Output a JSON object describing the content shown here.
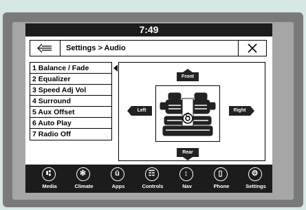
{
  "status": {
    "time": "7:49"
  },
  "header": {
    "breadcrumb": "Settings > Audio"
  },
  "menu": {
    "items": [
      {
        "label": "1 Balance / Fade"
      },
      {
        "label": "2 Equalizer"
      },
      {
        "label": "3 Speed Adj Vol"
      },
      {
        "label": "4 Surround"
      },
      {
        "label": "5 Aux Offset"
      },
      {
        "label": "6 Auto Play"
      },
      {
        "label": "7 Radio Off"
      }
    ]
  },
  "balance": {
    "front_label": "Front",
    "rear_label": "Rear",
    "left_label": "Left",
    "right_label": "Right",
    "center_label": "C"
  },
  "dock": {
    "items": [
      {
        "label": "Media",
        "icon": "usb-icon"
      },
      {
        "label": "Climate",
        "icon": "fan-icon"
      },
      {
        "label": "Apps",
        "icon": "apps-icon"
      },
      {
        "label": "Controls",
        "icon": "controls-icon"
      },
      {
        "label": "Nav",
        "icon": "nav-icon"
      },
      {
        "label": "Phone",
        "icon": "phone-icon"
      },
      {
        "label": "Settings",
        "icon": "gear-icon"
      }
    ]
  },
  "colors": {
    "screen_bg": "#1c1c1c",
    "content_bg": "#ffffff",
    "bezel": "#7a7a7a"
  }
}
